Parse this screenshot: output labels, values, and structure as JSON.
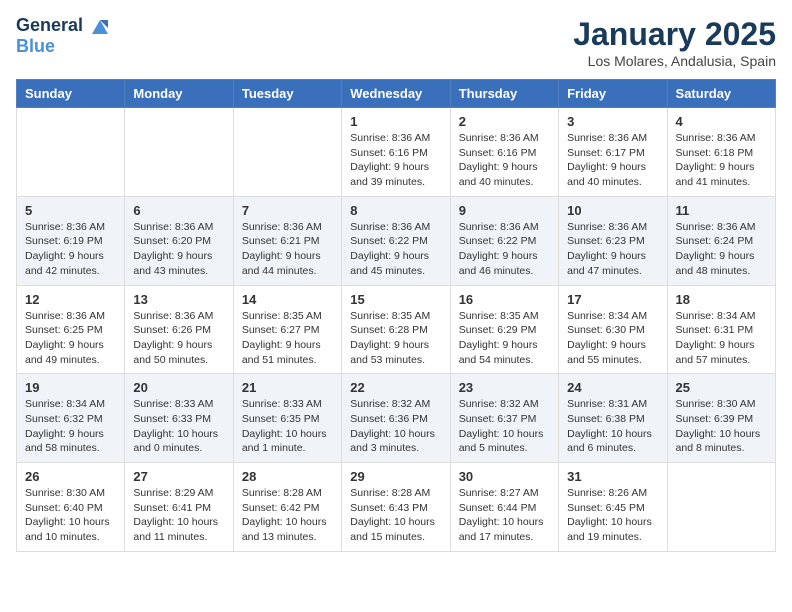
{
  "header": {
    "logo_line1": "General",
    "logo_line2": "Blue",
    "title": "January 2025",
    "subtitle": "Los Molares, Andalusia, Spain"
  },
  "weekdays": [
    "Sunday",
    "Monday",
    "Tuesday",
    "Wednesday",
    "Thursday",
    "Friday",
    "Saturday"
  ],
  "weeks": [
    [
      {
        "day": "",
        "info": ""
      },
      {
        "day": "",
        "info": ""
      },
      {
        "day": "",
        "info": ""
      },
      {
        "day": "1",
        "info": "Sunrise: 8:36 AM\nSunset: 6:16 PM\nDaylight: 9 hours and 39 minutes."
      },
      {
        "day": "2",
        "info": "Sunrise: 8:36 AM\nSunset: 6:16 PM\nDaylight: 9 hours and 40 minutes."
      },
      {
        "day": "3",
        "info": "Sunrise: 8:36 AM\nSunset: 6:17 PM\nDaylight: 9 hours and 40 minutes."
      },
      {
        "day": "4",
        "info": "Sunrise: 8:36 AM\nSunset: 6:18 PM\nDaylight: 9 hours and 41 minutes."
      }
    ],
    [
      {
        "day": "5",
        "info": "Sunrise: 8:36 AM\nSunset: 6:19 PM\nDaylight: 9 hours and 42 minutes."
      },
      {
        "day": "6",
        "info": "Sunrise: 8:36 AM\nSunset: 6:20 PM\nDaylight: 9 hours and 43 minutes."
      },
      {
        "day": "7",
        "info": "Sunrise: 8:36 AM\nSunset: 6:21 PM\nDaylight: 9 hours and 44 minutes."
      },
      {
        "day": "8",
        "info": "Sunrise: 8:36 AM\nSunset: 6:22 PM\nDaylight: 9 hours and 45 minutes."
      },
      {
        "day": "9",
        "info": "Sunrise: 8:36 AM\nSunset: 6:22 PM\nDaylight: 9 hours and 46 minutes."
      },
      {
        "day": "10",
        "info": "Sunrise: 8:36 AM\nSunset: 6:23 PM\nDaylight: 9 hours and 47 minutes."
      },
      {
        "day": "11",
        "info": "Sunrise: 8:36 AM\nSunset: 6:24 PM\nDaylight: 9 hours and 48 minutes."
      }
    ],
    [
      {
        "day": "12",
        "info": "Sunrise: 8:36 AM\nSunset: 6:25 PM\nDaylight: 9 hours and 49 minutes."
      },
      {
        "day": "13",
        "info": "Sunrise: 8:36 AM\nSunset: 6:26 PM\nDaylight: 9 hours and 50 minutes."
      },
      {
        "day": "14",
        "info": "Sunrise: 8:35 AM\nSunset: 6:27 PM\nDaylight: 9 hours and 51 minutes."
      },
      {
        "day": "15",
        "info": "Sunrise: 8:35 AM\nSunset: 6:28 PM\nDaylight: 9 hours and 53 minutes."
      },
      {
        "day": "16",
        "info": "Sunrise: 8:35 AM\nSunset: 6:29 PM\nDaylight: 9 hours and 54 minutes."
      },
      {
        "day": "17",
        "info": "Sunrise: 8:34 AM\nSunset: 6:30 PM\nDaylight: 9 hours and 55 minutes."
      },
      {
        "day": "18",
        "info": "Sunrise: 8:34 AM\nSunset: 6:31 PM\nDaylight: 9 hours and 57 minutes."
      }
    ],
    [
      {
        "day": "19",
        "info": "Sunrise: 8:34 AM\nSunset: 6:32 PM\nDaylight: 9 hours and 58 minutes."
      },
      {
        "day": "20",
        "info": "Sunrise: 8:33 AM\nSunset: 6:33 PM\nDaylight: 10 hours and 0 minutes."
      },
      {
        "day": "21",
        "info": "Sunrise: 8:33 AM\nSunset: 6:35 PM\nDaylight: 10 hours and 1 minute."
      },
      {
        "day": "22",
        "info": "Sunrise: 8:32 AM\nSunset: 6:36 PM\nDaylight: 10 hours and 3 minutes."
      },
      {
        "day": "23",
        "info": "Sunrise: 8:32 AM\nSunset: 6:37 PM\nDaylight: 10 hours and 5 minutes."
      },
      {
        "day": "24",
        "info": "Sunrise: 8:31 AM\nSunset: 6:38 PM\nDaylight: 10 hours and 6 minutes."
      },
      {
        "day": "25",
        "info": "Sunrise: 8:30 AM\nSunset: 6:39 PM\nDaylight: 10 hours and 8 minutes."
      }
    ],
    [
      {
        "day": "26",
        "info": "Sunrise: 8:30 AM\nSunset: 6:40 PM\nDaylight: 10 hours and 10 minutes."
      },
      {
        "day": "27",
        "info": "Sunrise: 8:29 AM\nSunset: 6:41 PM\nDaylight: 10 hours and 11 minutes."
      },
      {
        "day": "28",
        "info": "Sunrise: 8:28 AM\nSunset: 6:42 PM\nDaylight: 10 hours and 13 minutes."
      },
      {
        "day": "29",
        "info": "Sunrise: 8:28 AM\nSunset: 6:43 PM\nDaylight: 10 hours and 15 minutes."
      },
      {
        "day": "30",
        "info": "Sunrise: 8:27 AM\nSunset: 6:44 PM\nDaylight: 10 hours and 17 minutes."
      },
      {
        "day": "31",
        "info": "Sunrise: 8:26 AM\nSunset: 6:45 PM\nDaylight: 10 hours and 19 minutes."
      },
      {
        "day": "",
        "info": ""
      }
    ]
  ]
}
